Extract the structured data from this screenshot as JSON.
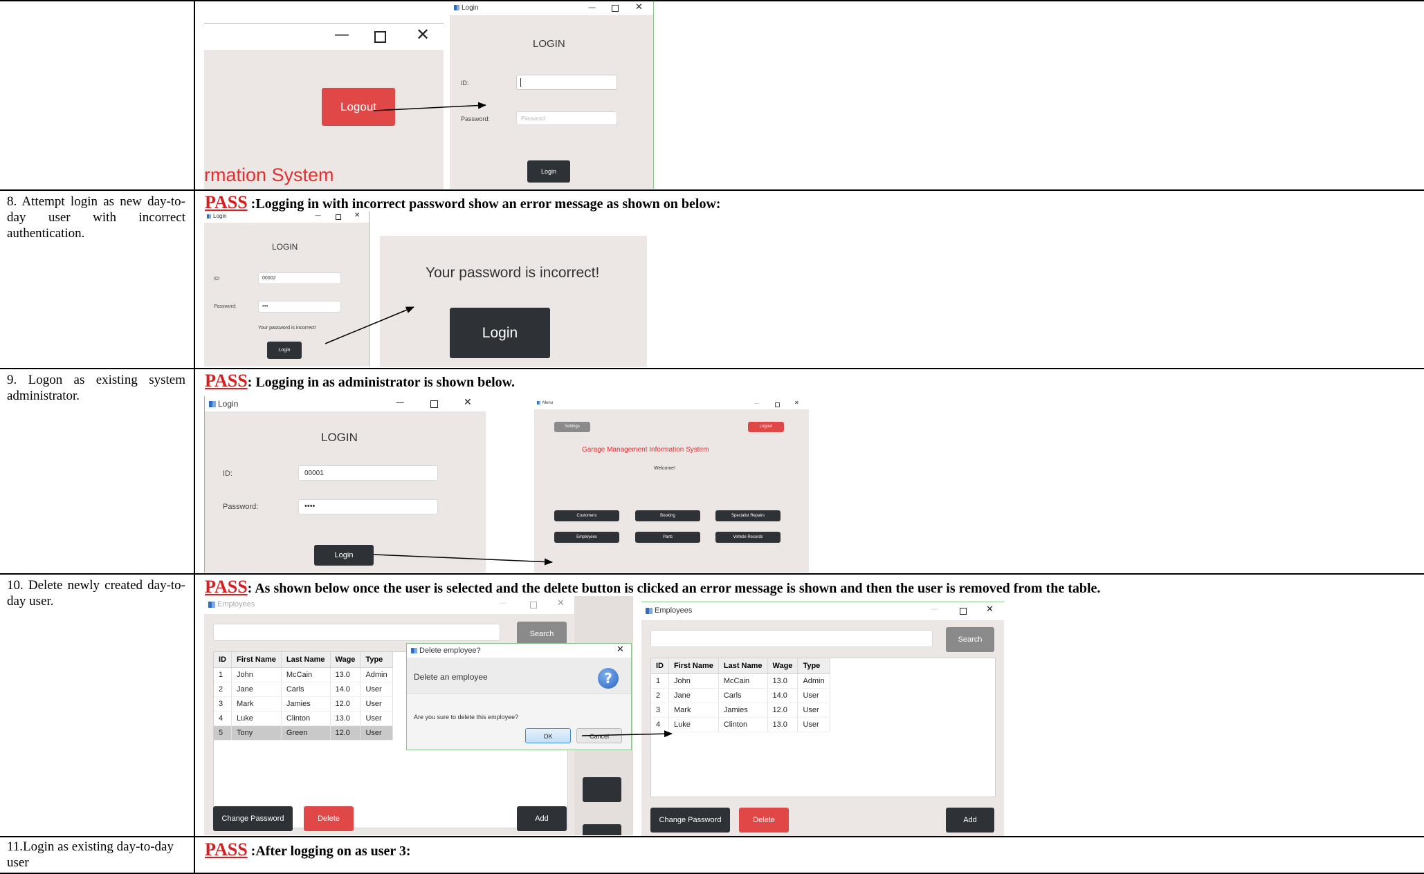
{
  "rows": [
    {
      "description": ""
    },
    {
      "description": "8. Attempt login as new day-to-day user with incorrect authentication.",
      "pass_label": "PASS",
      "result_text": " :Logging in with incorrect password show an error message as shown on below:"
    },
    {
      "description": "9. Logon as existing system administrator.",
      "pass_label": "PASS",
      "result_text": ": Logging in as administrator is shown below."
    },
    {
      "description": "10. Delete newly created day-to-day user.",
      "pass_label": "PASS",
      "result_text": ": As shown below once the user is selected and the delete button is clicked an error message is shown and then the user is removed from the table."
    },
    {
      "description": "11.Login as existing day-to-day user",
      "pass_label": "PASS",
      "result_text": " :After logging on as user 3:"
    }
  ],
  "shot1": {
    "logout_label": "Logout",
    "system_text": "rmation System",
    "login_window": {
      "title": "Login",
      "heading": "LOGIN",
      "id_label": "ID:",
      "password_label": "Password:",
      "password_placeholder": "Password",
      "button": "Login"
    }
  },
  "shot2": {
    "title": "Login",
    "heading": "LOGIN",
    "id_label": "ID:",
    "id_value": "00002",
    "password_label": "Password:",
    "password_value": "•••",
    "error_small": "Your password is incorrect!",
    "button": "Login",
    "zoom_error": "Your password is incorrect!",
    "zoom_button": "Login"
  },
  "shot3": {
    "title": "Login",
    "heading": "LOGIN",
    "id_label": "ID:",
    "id_value": "00001",
    "password_label": "Password:",
    "password_value": "••••",
    "button": "Login",
    "menu": {
      "title": "Menu",
      "settings": "Settings",
      "logout": "Logout",
      "system_title": "Garage Management Information System",
      "welcome": "Welcome!",
      "buttons": [
        "Customers",
        "Booking",
        "Specialist Repairs",
        "Employees",
        "Parts",
        "Vehicle Records"
      ]
    }
  },
  "shot4": {
    "window_title": "Employees",
    "search_label": "Search",
    "columns": [
      "ID",
      "First Name",
      "Last Name",
      "Wage",
      "Type"
    ],
    "before_rows": [
      [
        "1",
        "John",
        "McCain",
        "13.0",
        "Admin"
      ],
      [
        "2",
        "Jane",
        "Carls",
        "14.0",
        "User"
      ],
      [
        "3",
        "Mark",
        "Jamies",
        "12.0",
        "User"
      ],
      [
        "4",
        "Luke",
        "Clinton",
        "13.0",
        "User"
      ],
      [
        "5",
        "Tony",
        "Green",
        "12.0",
        "User"
      ]
    ],
    "after_rows": [
      [
        "1",
        "John",
        "McCain",
        "13.0",
        "Admin"
      ],
      [
        "2",
        "Jane",
        "Carls",
        "14.0",
        "User"
      ],
      [
        "3",
        "Mark",
        "Jamies",
        "12.0",
        "User"
      ],
      [
        "4",
        "Luke",
        "Clinton",
        "13.0",
        "User"
      ]
    ],
    "change_password": "Change Password",
    "delete": "Delete",
    "add": "Add",
    "dialog": {
      "title": "Delete employee?",
      "header": "Delete an employee",
      "message": "Are you sure to delete this employee?",
      "ok": "OK",
      "cancel": "Cancel"
    }
  },
  "colors": {
    "pass": "#d42020",
    "danger_button": "#e04848",
    "dark_button": "#2e3136",
    "window_bg": "#ece7e5",
    "system_title": "#e03030"
  }
}
